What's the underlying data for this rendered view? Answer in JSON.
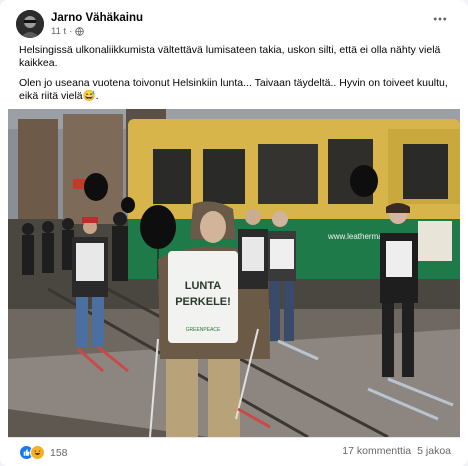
{
  "post": {
    "author": "Jarno Vähäkainu",
    "time": "11 t",
    "separator": "·",
    "paragraphs": [
      "Helsingissä ulkonaliikkumista vältettävä lumisateen takia, uskon silti, että ei olla nähty vielä kaikkea.",
      "Olen jo useana vuotena toivonut Helsinkiin lunta... Taivaan täydeltä.. Hyvin on toiveet kuultu, eikä riitä vielä😅."
    ],
    "image": {
      "sign_line1": "LUNTA",
      "sign_line2": "PERKELE!",
      "sign_small": "GREENPEACE",
      "tram_text": "www.leatherman.fi"
    }
  },
  "footer": {
    "reactions_count": "158",
    "comments": "17 kommenttia",
    "shares": "5 jakoa"
  },
  "colors": {
    "brand_blue": "#1877f2",
    "tram_yellow": "#d7b54a",
    "tram_green": "#1f7a4a"
  },
  "icons": [
    "avatar",
    "globe-icon",
    "more-options-icon",
    "like-icon",
    "haha-icon"
  ]
}
